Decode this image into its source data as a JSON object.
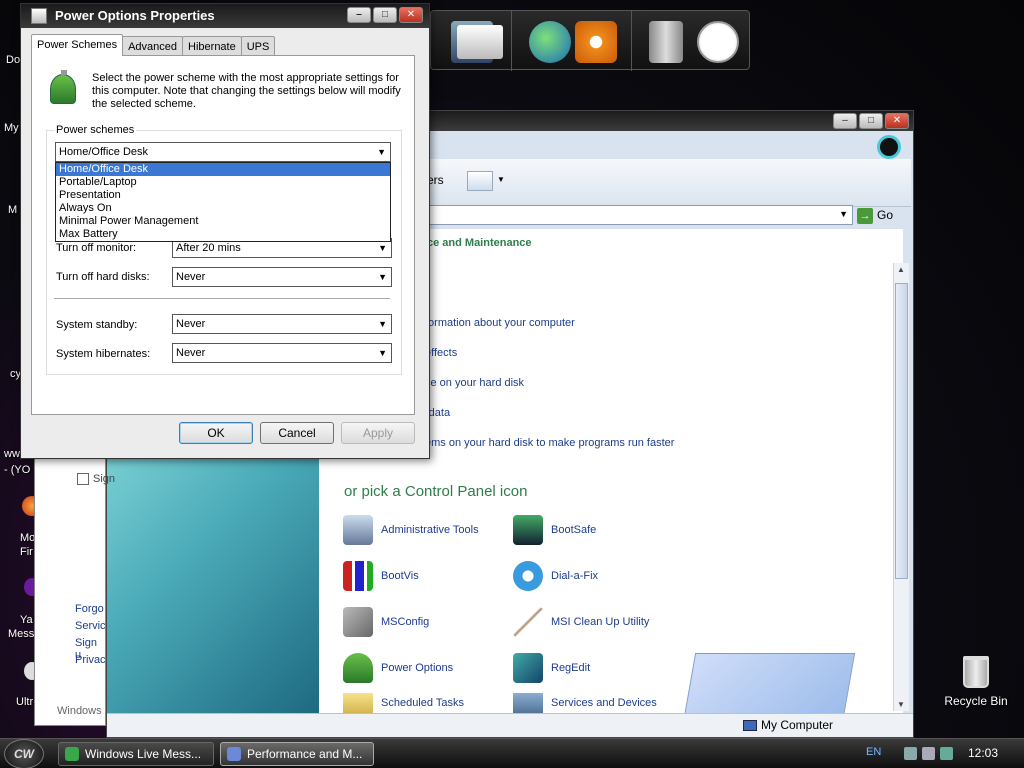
{
  "desktop": {
    "fragments": [
      "Do",
      "My",
      "M",
      "cy",
      "ww",
      "- (YO",
      "Mo",
      "Fir",
      "Ya",
      "Mess",
      "Ultr",
      "Windows"
    ],
    "recycle_bin_label": "Recycle Bin"
  },
  "dialog": {
    "title": "Power Options Properties",
    "tabs": [
      "Power Schemes",
      "Advanced",
      "Hibernate",
      "UPS"
    ],
    "intro": "Select the power scheme with the most appropriate settings for this computer. Note that changing the settings below will modify the selected scheme.",
    "group_label": "Power schemes",
    "scheme_selected": "Home/Office Desk",
    "scheme_options": [
      "Home/Office Desk",
      "Portable/Laptop",
      "Presentation",
      "Always On",
      "Minimal Power Management",
      "Max Battery"
    ],
    "rows": [
      {
        "label": "Turn off monitor:",
        "value": "After 20 mins"
      },
      {
        "label": "Turn off hard disks:",
        "value": "Never"
      },
      {
        "label": "System standby:",
        "value": "Never"
      },
      {
        "label": "System hibernates:",
        "value": "Never"
      }
    ],
    "buttons": {
      "ok": "OK",
      "cancel": "Cancel",
      "apply": "Apply"
    }
  },
  "explorer": {
    "toolbar_text": "ers",
    "address_go": "Go",
    "category_heading": "ce and Maintenance",
    "tasks": [
      "formation about your computer",
      "effects",
      "ce on your hard disk",
      "rdata",
      "ems on your hard disk to make programs run faster"
    ],
    "pick_heading": "or pick a Control Panel icon",
    "cp_icons": [
      "Administrative Tools",
      "BootSafe",
      "BootVis",
      "Dial-a-Fix",
      "MSConfig",
      "MSI Clean Up Utility",
      "Power Options",
      "RegEdit",
      "Scheduled Tasks",
      "Services and Devices"
    ],
    "left_fragments": [
      "Sign",
      "Forgo",
      "Servic",
      "Sign u",
      "Privac"
    ],
    "status_text": "My Computer"
  },
  "taskbar": {
    "start_label": "CW",
    "buttons": [
      "Windows Live Mess...",
      "Performance and M..."
    ],
    "language": "EN",
    "clock": "12:03"
  }
}
